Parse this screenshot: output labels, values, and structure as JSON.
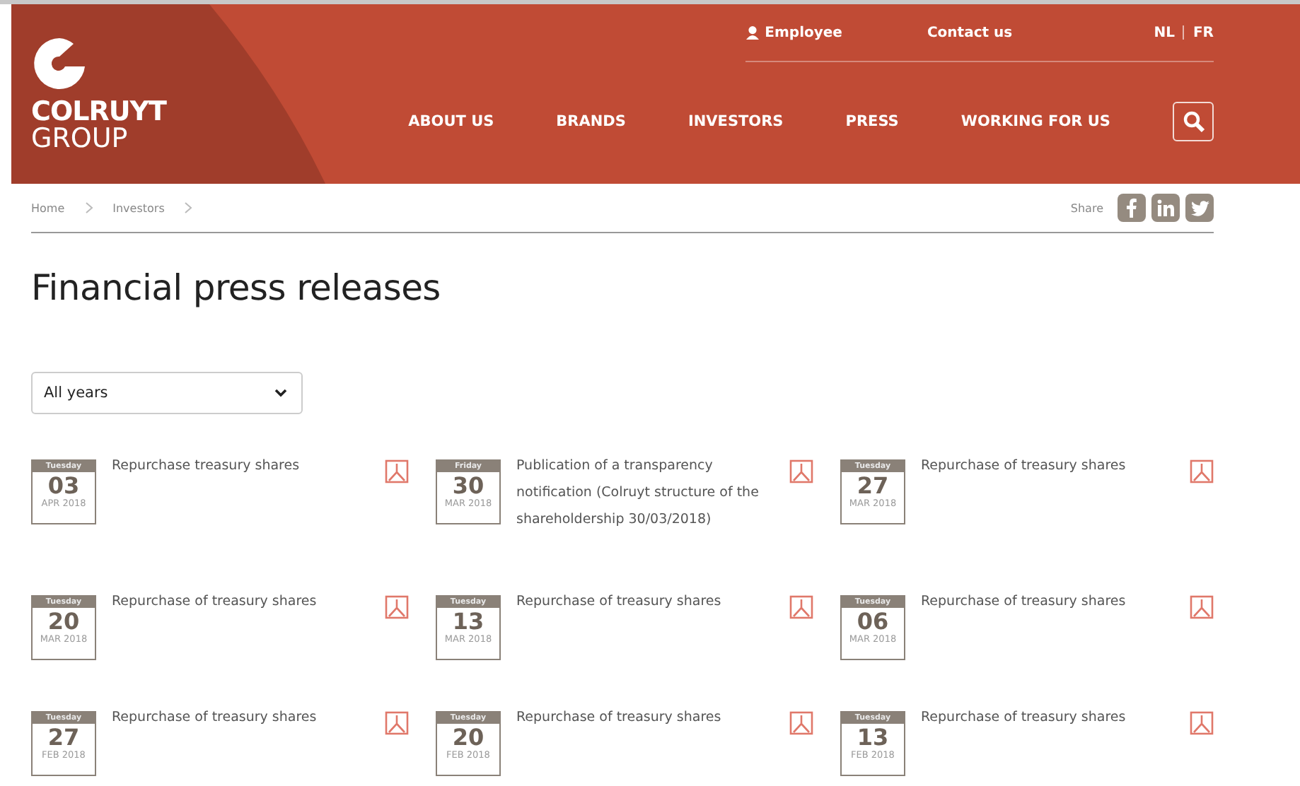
{
  "header": {
    "logo": {
      "line1": "COLRUYT",
      "line2": "GROUP"
    },
    "top_links": [
      {
        "label": "Employee",
        "kind": "person"
      },
      {
        "label": "Contact us",
        "kind": "plain"
      }
    ],
    "languages": [
      "NL",
      "FR"
    ],
    "nav": [
      "ABOUT US",
      "BRANDS",
      "INVESTORS",
      "PRESS",
      "WORKING FOR US"
    ]
  },
  "breadcrumb": [
    "Home",
    "Investors"
  ],
  "share": {
    "label": "Share",
    "buttons": [
      {
        "kind": "facebook"
      },
      {
        "kind": "linkedin"
      },
      {
        "kind": "twitter"
      }
    ]
  },
  "title": "Financial press releases",
  "year_filter": {
    "value": "All years"
  },
  "releases": [
    {
      "weekday": "Tuesday",
      "day": "03",
      "month_year": "APR 2018",
      "title": "Repurchase treasury shares"
    },
    {
      "weekday": "Friday",
      "day": "30",
      "month_year": "MAR 2018",
      "title": "Publication of a transparency notification (Colruyt structure of the shareholdership 30/03/2018)"
    },
    {
      "weekday": "Tuesday",
      "day": "27",
      "month_year": "MAR 2018",
      "title": "Repurchase of treasury shares"
    },
    {
      "weekday": "Tuesday",
      "day": "20",
      "month_year": "MAR 2018",
      "title": "Repurchase of treasury shares"
    },
    {
      "weekday": "Tuesday",
      "day": "13",
      "month_year": "MAR 2018",
      "title": "Repurchase of treasury shares"
    },
    {
      "weekday": "Tuesday",
      "day": "06",
      "month_year": "MAR 2018",
      "title": "Repurchase of treasury shares"
    },
    {
      "weekday": "Tuesday",
      "day": "27",
      "month_year": "FEB 2018",
      "title": "Repurchase of treasury shares"
    },
    {
      "weekday": "Tuesday",
      "day": "20",
      "month_year": "FEB 2018",
      "title": "Repurchase of treasury shares"
    },
    {
      "weekday": "Tuesday",
      "day": "13",
      "month_year": "FEB 2018",
      "title": "Repurchase of treasury shares"
    }
  ]
}
